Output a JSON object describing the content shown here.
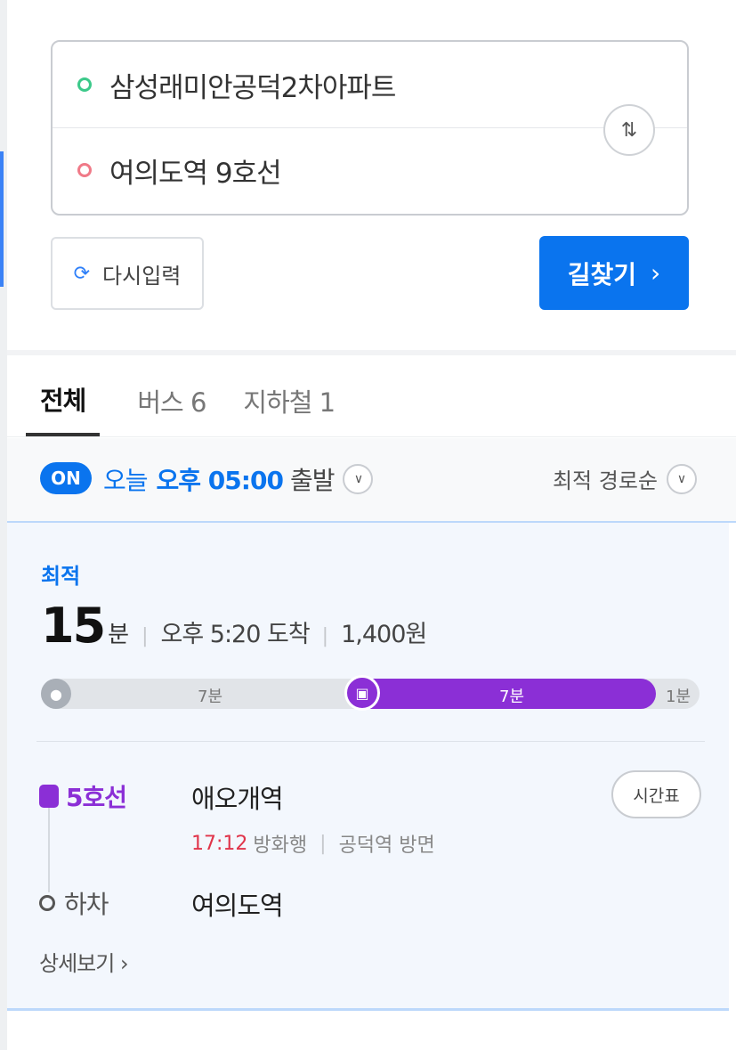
{
  "search": {
    "origin": "삼성래미안공덕2차아파트",
    "destination": "여의도역 9호선",
    "swap_glyph": "⇅"
  },
  "actions": {
    "reset_label": "다시입력",
    "find_label": "길찾기",
    "find_chevron": "›"
  },
  "tabs": [
    {
      "label": "전체",
      "active": true
    },
    {
      "label": "버스 6",
      "active": false
    },
    {
      "label": "지하철 1",
      "active": false
    }
  ],
  "filter": {
    "on_badge": "ON",
    "today": "오늘",
    "time": "오후 05:00",
    "suffix": "출발",
    "sort_label": "최적 경로순"
  },
  "route": {
    "tag": "최적",
    "duration_num": "15",
    "duration_unit": "분",
    "arrival": "오후 5:20 도착",
    "fare": "1,400원",
    "segments": {
      "walk_label": "7분",
      "subway_label": "7분",
      "end_label": "1분"
    },
    "board": {
      "line": "5호선",
      "station": "애오개역",
      "time": "17:12",
      "direction": "방화행",
      "platform": "공덕역 방면",
      "timetable_label": "시간표"
    },
    "alight": {
      "label": "하차",
      "station": "여의도역"
    },
    "detail_label": "상세보기 ›"
  },
  "colors": {
    "accent": "#0a74ee",
    "line5": "#8b2fd6",
    "board_time": "#e0344a"
  }
}
